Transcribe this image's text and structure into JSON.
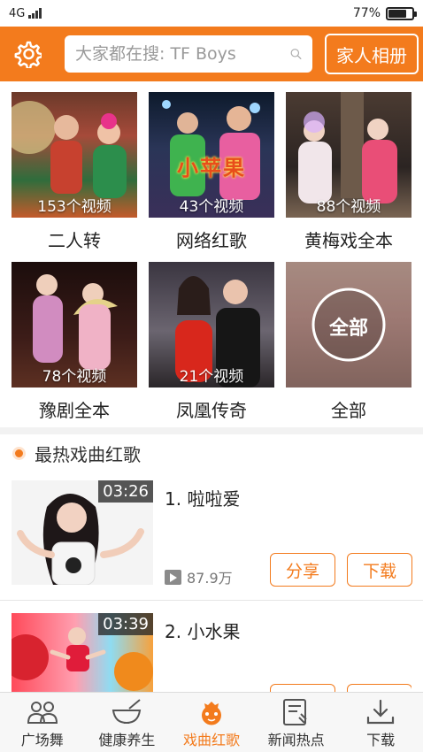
{
  "status": {
    "network": "4G",
    "battery": "77%",
    "battery_level": 0.77
  },
  "header": {
    "search_placeholder": "大家都在搜: TF Boys",
    "family_button": "家人相册",
    "icons": [
      "gear-icon",
      "search-icon"
    ]
  },
  "categories": [
    {
      "label": "二人转",
      "count": "153个视频"
    },
    {
      "label": "网络红歌",
      "count": "43个视频",
      "overlay": "小苹果"
    },
    {
      "label": "黄梅戏全本",
      "count": "88个视频"
    },
    {
      "label": "豫剧全本",
      "count": "78个视频"
    },
    {
      "label": "凤凰传奇",
      "count": "21个视频"
    },
    {
      "label": "全部",
      "badge": "全部"
    }
  ],
  "section": {
    "title": "最热戏曲红歌"
  },
  "songs": [
    {
      "title": "1. 啦啦爱",
      "duration": "03:26",
      "plays": "87.9万",
      "share": "分享",
      "download": "下载"
    },
    {
      "title": "2. 小水果",
      "duration": "03:39"
    }
  ],
  "tabs": [
    {
      "label": "广场舞",
      "icon": "people-icon"
    },
    {
      "label": "健康养生",
      "icon": "bowl-icon"
    },
    {
      "label": "戏曲红歌",
      "icon": "opera-icon",
      "active": true
    },
    {
      "label": "新闻热点",
      "icon": "news-icon"
    },
    {
      "label": "下载",
      "icon": "download-icon"
    }
  ],
  "colors": {
    "accent": "#f37b1d"
  }
}
